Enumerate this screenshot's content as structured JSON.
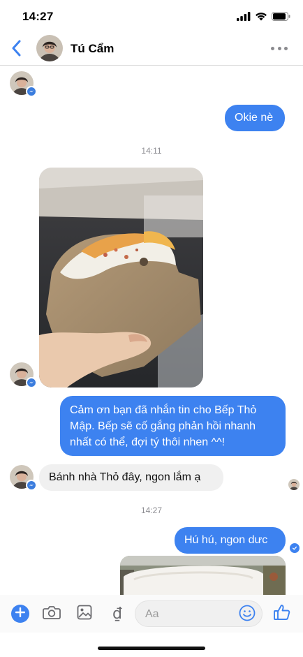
{
  "status_bar": {
    "time": "14:27",
    "icons": [
      "signal-icon",
      "wifi-icon",
      "battery-icon"
    ]
  },
  "header": {
    "back_icon": "chevron-left-icon",
    "contact_name": "Tú Cẩm",
    "more_icon": "more-horizontal-icon"
  },
  "messages": {
    "out_1": "Okie nè",
    "timestamp_1": "14:11",
    "out_2": "Cảm ơn bạn đã nhắn tin cho Bếp Thỏ Mập. Bếp sẽ cố gắng phản hồi nhanh nhất có thể, đợi tý thôi nhen ^^!",
    "in_1": "Bánh nhà Thỏ đây, ngon lắm ạ",
    "timestamp_2": "14:27",
    "out_3": "Hú hú, ngon dưc"
  },
  "composer": {
    "placeholder": "Aa",
    "currency_glyph": "₫",
    "icons": [
      "plus-icon",
      "camera-icon",
      "gallery-icon",
      "currency-icon",
      "emoji-icon",
      "thumbs-up-icon"
    ]
  },
  "colors": {
    "accent": "#3d82f0",
    "incoming_bubble": "#f0f0f0",
    "header_name": "#000000"
  }
}
